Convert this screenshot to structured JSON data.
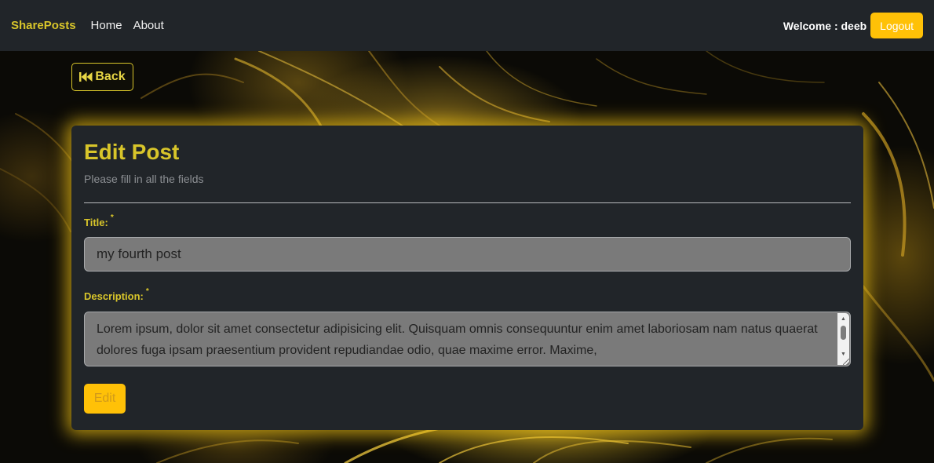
{
  "navbar": {
    "brand": "SharePosts",
    "links": [
      "Home",
      "About"
    ],
    "welcome": "Welcome : deeb",
    "logout_label": "Logout"
  },
  "back_button": {
    "label": "Back",
    "icon": "backward-icon"
  },
  "form": {
    "title": "Edit Post",
    "subtitle": "Please fill in all the fields",
    "title_label": "Title:",
    "title_value": "my fourth post",
    "description_label": "Description:",
    "required_mark": "*",
    "description_value": "Lorem ipsum, dolor sit amet consectetur adipisicing elit. Quisquam omnis consequuntur enim amet laboriosam nam natus quaerat dolores fuga ipsam praesentium provident repudiandae odio, quae maxime error. Maxime,",
    "submit_label": "Edit"
  },
  "colors": {
    "accent": "#d8c52a",
    "button": "#ffc107",
    "navbar_bg": "#212529",
    "card_bg": "#212529",
    "input_bg": "#7a7a7a"
  }
}
